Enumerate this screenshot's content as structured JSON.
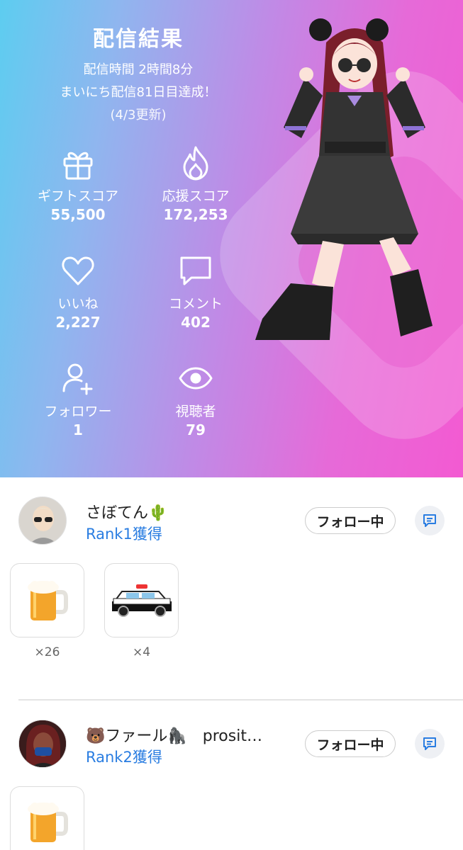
{
  "hero": {
    "title": "配信結果",
    "duration": "配信時間 2時間8分",
    "streak": "まいにち配信81日目達成！",
    "updated": "(4/3更新)"
  },
  "stats": [
    {
      "icon": "gift-icon",
      "label": "ギフトスコア",
      "value": "55,500"
    },
    {
      "icon": "flame-icon",
      "label": "応援スコア",
      "value": "172,253"
    },
    {
      "icon": "heart-icon",
      "label": "いいね",
      "value": "2,227"
    },
    {
      "icon": "comment-icon",
      "label": "コメント",
      "value": "402"
    },
    {
      "icon": "add-user-icon",
      "label": "フォロワー",
      "value": "1"
    },
    {
      "icon": "eye-icon",
      "label": "視聴者",
      "value": "79"
    }
  ],
  "supporters": [
    {
      "name": "さぼてん🌵",
      "rank": "Rank1獲得",
      "follow_label": "フォロー中",
      "gifts": [
        {
          "icon": "beer-mug-icon",
          "count": "×26"
        },
        {
          "icon": "police-car-icon",
          "count": "×4"
        }
      ]
    },
    {
      "name": "🐻ファール🦍　prosit…",
      "rank": "Rank2獲得",
      "follow_label": "フォロー中",
      "gifts": [
        {
          "icon": "beer-mug-icon"
        }
      ]
    }
  ],
  "colors": {
    "gradient_start": "#5dcdf0",
    "gradient_end": "#f35ad2",
    "rank_blue": "#2a7de1"
  }
}
